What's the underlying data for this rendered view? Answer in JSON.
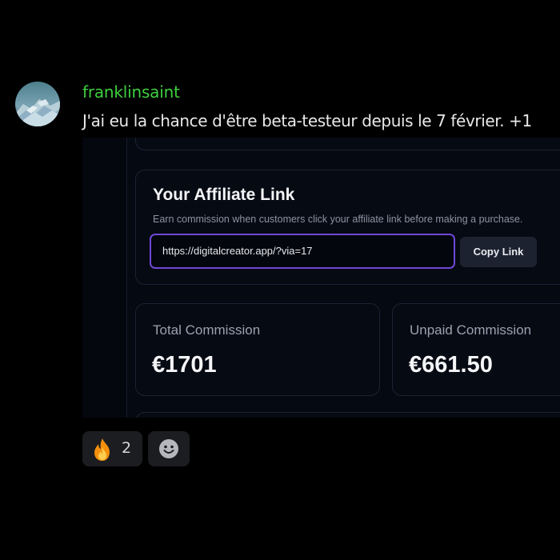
{
  "message": {
    "username": "franklinsaint",
    "text": "J'ai eu la chance d'être beta-testeur depuis le 7 février. +1",
    "colors": {
      "username": "#3ecf3e",
      "text": "#e8e8e8"
    }
  },
  "embed": {
    "affiliate": {
      "title": "Your Affiliate Link",
      "subtitle": "Earn commission when customers click your affiliate link before making a purchase.",
      "link_value": "https://digitalcreator.app/?via=17",
      "copy_label": "Copy Link",
      "accent": "#7047d8"
    },
    "stats": [
      {
        "label": "Total Commission",
        "value": "€1701"
      },
      {
        "label": "Unpaid Commission",
        "value": "€661.50"
      }
    ]
  },
  "reactions": [
    {
      "icon": "fire-emoji",
      "count": "2"
    }
  ],
  "add_reaction_icon": "smiley-add-reaction-icon"
}
